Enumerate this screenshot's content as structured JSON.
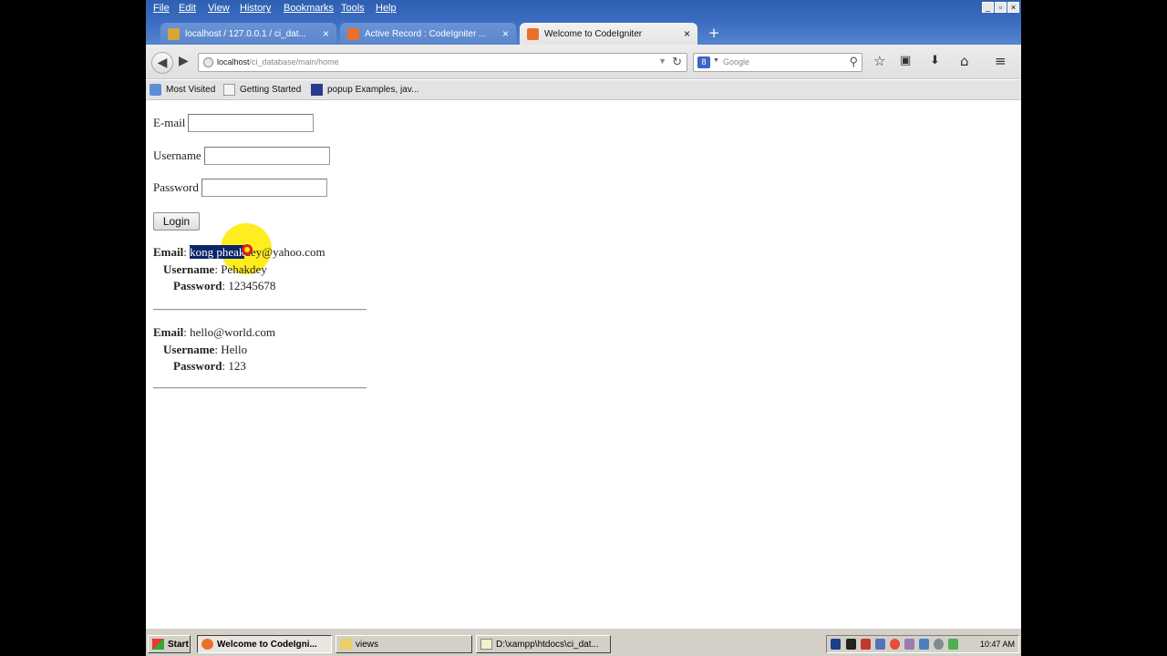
{
  "menubar": {
    "items": [
      "File",
      "Edit",
      "View",
      "History",
      "Bookmarks",
      "Tools",
      "Help"
    ]
  },
  "window_controls": [
    "_",
    "▫",
    "×"
  ],
  "tabs": [
    {
      "label": "localhost / 127.0.0.1 / ci_dat...",
      "close": "×",
      "active": false
    },
    {
      "label": "Active Record : CodeIgniter ...",
      "close": "×",
      "active": false
    },
    {
      "label": "Welcome to CodeIgniter",
      "close": "×",
      "active": true
    }
  ],
  "new_tab": "+",
  "navbar": {
    "url_host": "localhost",
    "url_path": "/ci_database/main/home",
    "search_placeholder": "Google"
  },
  "bookmarks": [
    "Most Visited",
    "Getting Started",
    "popup Examples, jav..."
  ],
  "form": {
    "email_label": "E-mail",
    "email_value": "",
    "username_label": "Username",
    "username_value": "",
    "password_label": "Password",
    "password_value": "",
    "login_label": "Login"
  },
  "records": [
    {
      "email_label": "Email",
      "email_selected": "kong pheak",
      "email_rest": "dey@yahoo.com",
      "username_label": "Username",
      "username_value": "Pehakdey",
      "password_label": "Password",
      "password_value": "12345678"
    },
    {
      "email_label": "Email",
      "email_value": "hello@world.com",
      "username_label": "Username",
      "username_value": "Hello",
      "password_label": "Password",
      "password_value": "123"
    }
  ],
  "taskbar": {
    "start": "Start",
    "items": [
      "Welcome to CodeIgni...",
      "views",
      "D:\\xampp\\htdocs\\ci_dat..."
    ],
    "clock": "10:47 AM"
  },
  "colors": {
    "titlebar": "#2f5fb0",
    "selection": "#0a246a",
    "cursor_highlight": "#ffeb00"
  }
}
